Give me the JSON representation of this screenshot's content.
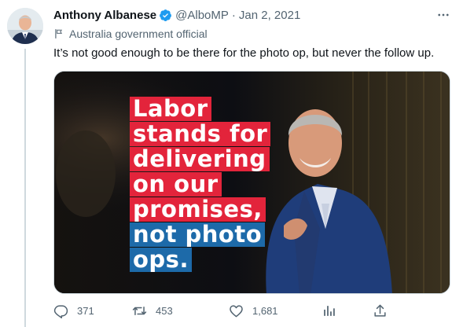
{
  "tweet": {
    "author_name": "Anthony Albanese",
    "handle": "@AlboMP",
    "separator": "·",
    "date": "Jan 2, 2021",
    "account_label": "Australia government official",
    "text": "It’s not good enough to be there for the photo op, but never the follow up."
  },
  "media": {
    "headline_lines": [
      {
        "text": "Labor",
        "color": "#e3243b"
      },
      {
        "text": "stands for",
        "color": "#e3243b"
      },
      {
        "text": "delivering",
        "color": "#e3243b"
      },
      {
        "text": "on our",
        "color": "#e3243b"
      },
      {
        "text": "promises,",
        "color": "#e3243b"
      },
      {
        "text": "not photo",
        "color": "#1d6aa9"
      },
      {
        "text": "ops.",
        "color": "#1d6aa9"
      }
    ]
  },
  "actions": {
    "replies": "371",
    "retweets": "453",
    "likes": "1,681"
  },
  "colors": {
    "verified": "#1d9bf0",
    "secondary_text": "#536471",
    "headline_red": "#e3243b",
    "headline_blue": "#1d6aa9"
  },
  "icons": [
    "verified-badge-icon",
    "more-options-icon",
    "government-flag-icon",
    "reply-icon",
    "retweet-icon",
    "like-icon",
    "analytics-icon",
    "share-icon"
  ]
}
